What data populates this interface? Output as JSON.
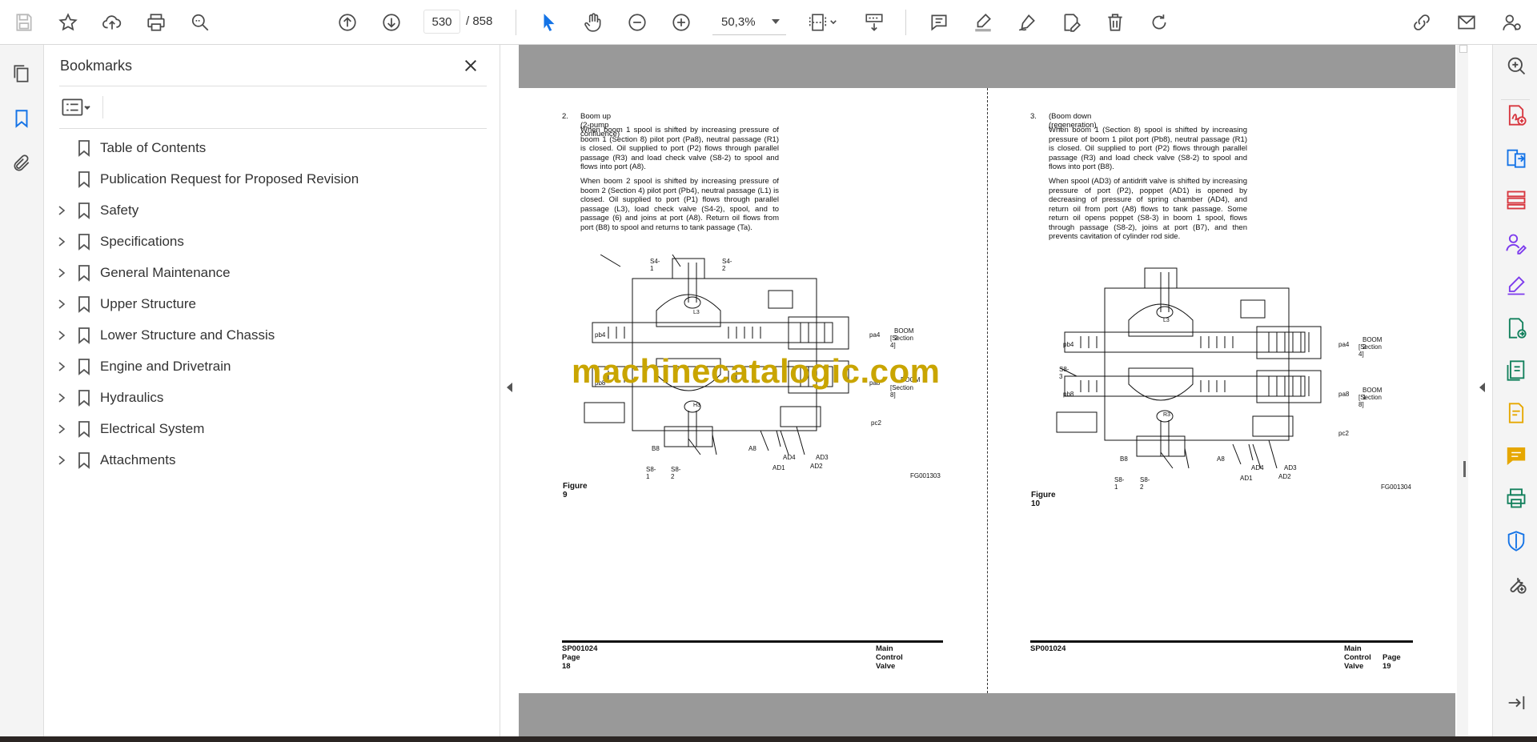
{
  "toolbar": {
    "page_current": "530",
    "page_total": "/  858",
    "zoom": "50,3%"
  },
  "bookmarks": {
    "title": "Bookmarks",
    "items": [
      {
        "label": "Table of Contents",
        "expandable": false
      },
      {
        "label": "Publication Request for Proposed Revision",
        "expandable": false
      },
      {
        "label": "Safety",
        "expandable": true
      },
      {
        "label": "Specifications",
        "expandable": true
      },
      {
        "label": "General Maintenance",
        "expandable": true
      },
      {
        "label": "Upper Structure",
        "expandable": true
      },
      {
        "label": "Lower Structure and Chassis",
        "expandable": true
      },
      {
        "label": "Engine and Drivetrain",
        "expandable": true
      },
      {
        "label": "Hydraulics",
        "expandable": true
      },
      {
        "label": "Electrical System",
        "expandable": true
      },
      {
        "label": "Attachments",
        "expandable": true
      }
    ]
  },
  "document": {
    "left_page": {
      "section_number": "2.",
      "section_title": "Boom up (2-pump confluence)",
      "para1": "When boom 1 spool is shifted by increasing pressure of boom 1 (Section 8) pilot port (Pa8), neutral passage (R1) is closed. Oil supplied to port (P2) flows through parallel passage (R3) and load check valve (S8-2) to spool and flows into port (A8).",
      "para2": "When boom 2 spool is shifted by increasing pressure of boom 2 (Section 4) pilot port (Pb4), neutral passage (L1) is closed. Oil supplied to port (P1) flows through parallel passage (L3), load check valve (S4-2), spool, and to passage (6) and joins at port (A8). Return oil flows from port (B8) to spool and returns to tank passage (Ta).",
      "figure_caption": "Figure 9",
      "figure_code": "FG001303",
      "labels": {
        "s4_1": "S4-1",
        "s4_2": "S4-2",
        "pb4": "pb4",
        "pa4": "pa4",
        "boom2": "BOOM 2",
        "sec4": "[Section 4]",
        "pb8": "pb8",
        "pa8": "pa8",
        "boom1": "BOOM",
        "sec8": "[Section 8]",
        "pc2": "pc2",
        "b8": "B8",
        "a8": "A8",
        "s8_1": "S8-1",
        "s8_2": "S8-2",
        "ad1": "AD1",
        "ad2": "AD2",
        "ad3": "AD3",
        "ad4": "AD4",
        "l3": "L3",
        "h3": "H3"
      },
      "footer_left_1": "SP001024",
      "footer_left_2": "Page 18",
      "footer_right": "Main Control Valve"
    },
    "right_page": {
      "section_number": "3.",
      "section_title": "(Boom down (regeneration)",
      "para1": "When boom 1 (Section 8) spool is shifted by increasing pressure of boom 1 pilot port (Pb8), neutral passage (R1) is closed. Oil supplied to port (P2) flows through parallel passage (R3) and load check valve (S8-2) to spool and flows into port (B8).",
      "para2": "When spool (AD3) of antidrift valve is shifted by increasing pressure of port (P2), poppet (AD1) is opened by decreasing of pressure of spring chamber (AD4), and return oil from port (A8) flows to tank passage. Some return oil opens poppet (S8-3) in boom 1 spool, flows through passage (S8-2), joins at port (B7), and then prevents cavitation of cylinder rod side.",
      "figure_caption": "Figure 10",
      "figure_code": "FG001304",
      "labels": {
        "pb4": "pb4",
        "pa4": "pa4",
        "boom2": "BOOM 2",
        "sec4": "[Section 4]",
        "s8_3": "S8-3",
        "pb8": "pb8",
        "pa8": "pa8",
        "boom1": "BOOM 1",
        "sec8": "[Section 8]",
        "pc2": "pc2",
        "b8": "B8",
        "a8": "A8",
        "s8_1": "S8-1",
        "s8_2": "S8-2",
        "ad1": "AD1",
        "ad2": "AD2",
        "ad3": "AD3",
        "ad4": "AD4",
        "l3": "L3",
        "r3": "R3"
      },
      "footer_left_1": "SP001024",
      "footer_left_2": "Page 19",
      "footer_right": "Main Control Valve"
    },
    "watermark": "machinecatalogic.com"
  },
  "colors": {
    "accent_blue": "#1473e6",
    "icon_gray": "#4b4b4b",
    "red": "#d7373f",
    "purple": "#7c3aed",
    "green": "#12805c",
    "yellow": "#e6a700",
    "watermark": "#c9a500"
  }
}
